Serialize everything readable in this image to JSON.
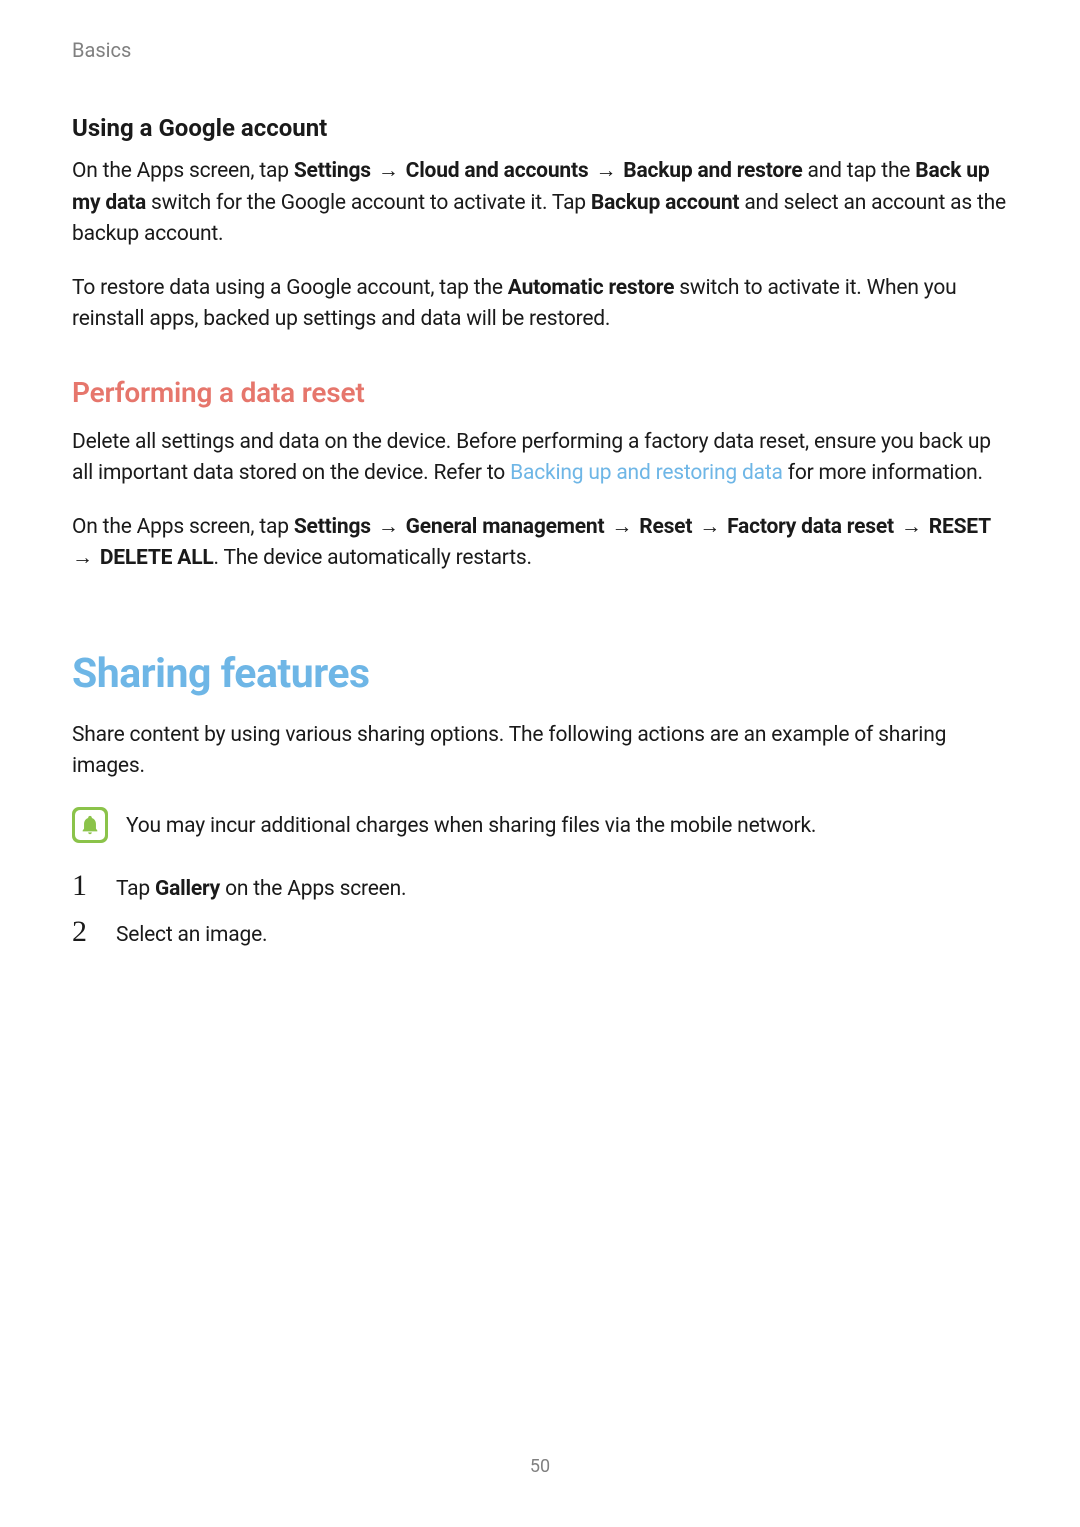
{
  "header": {
    "section": "Basics"
  },
  "subheading1": "Using a Google account",
  "para1": {
    "t1": "On the Apps screen, tap ",
    "b1": "Settings",
    "a1": " → ",
    "b2": "Cloud and accounts",
    "a2": " → ",
    "b3": "Backup and restore",
    "t2": " and tap the ",
    "b4": "Back up my data",
    "t3": " switch for the Google account to activate it. Tap ",
    "b5": "Backup account",
    "t4": " and select an account as the backup account."
  },
  "para2": {
    "t1": "To restore data using a Google account, tap the ",
    "b1": "Automatic restore",
    "t2": " switch to activate it. When you reinstall apps, backed up settings and data will be restored."
  },
  "section_heading": "Performing a data reset",
  "para3": {
    "t1": "Delete all settings and data on the device. Before performing a factory data reset, ensure you back up all important data stored on the device. Refer to ",
    "link": "Backing up and restoring data",
    "t2": " for more information."
  },
  "para4": {
    "t1": "On the Apps screen, tap ",
    "b1": "Settings",
    "a1": " → ",
    "b2": "General management",
    "a2": " → ",
    "b3": "Reset",
    "a3": " → ",
    "b4": "Factory data reset",
    "a4": " → ",
    "b5": "RESET",
    "a5": " → ",
    "b6": "DELETE ALL",
    "t2": ". The device automatically restarts."
  },
  "major_heading": "Sharing features",
  "para5": "Share content by using various sharing options. The following actions are an example of sharing images.",
  "note": "You may incur additional charges when sharing files via the mobile network.",
  "steps": [
    {
      "num": "1",
      "prefix": "Tap ",
      "bold": "Gallery",
      "suffix": " on the Apps screen."
    },
    {
      "num": "2",
      "prefix": "",
      "bold": "",
      "suffix": "Select an image."
    }
  ],
  "page_number": "50"
}
